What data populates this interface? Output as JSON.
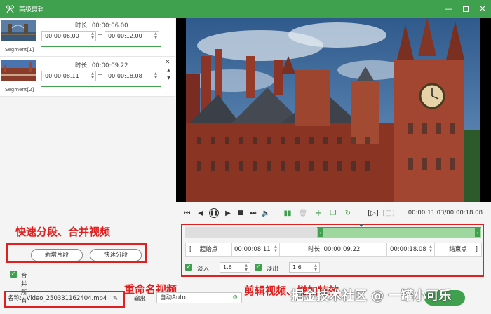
{
  "window": {
    "title": "高级剪辑"
  },
  "segments": [
    {
      "label": "Segment[1]",
      "duration_label": "时长:",
      "duration": "00:00:06.00",
      "start": "00:00:06.00",
      "end": "00:00:12.00"
    },
    {
      "label": "Segment[2]",
      "duration_label": "时长:",
      "duration": "00:00:09.22",
      "start": "00:00:08.11",
      "end": "00:00:18.08"
    }
  ],
  "controls": {
    "timecode": "00:00:11.03/00:00:18.08"
  },
  "editor": {
    "start_btn": "起始点",
    "start_time": "00:00:08.11",
    "duration_label": "时长:",
    "duration": "00:00:09.22",
    "end_time": "00:00:18.08",
    "end_btn": "结束点",
    "fade_in_label": "淡入",
    "fade_in_value": "1.6",
    "fade_out_label": "淡出",
    "fade_out_value": "1.6"
  },
  "annotations": {
    "segment_merge": "快速分段、合并视频",
    "rename": "重命名视频",
    "edit": "剪辑视频、增加特效"
  },
  "buttons": {
    "add_segment": "新增片段",
    "quick_split": "快速分段",
    "merge_all": "合并所有"
  },
  "output": {
    "name_label": "名称:",
    "name_value": "Video_250331162404.mp4",
    "output_label": "输出:",
    "output_value": "自动Auto"
  },
  "watermark": "掘金技术社区 @ 一罐小可乐"
}
